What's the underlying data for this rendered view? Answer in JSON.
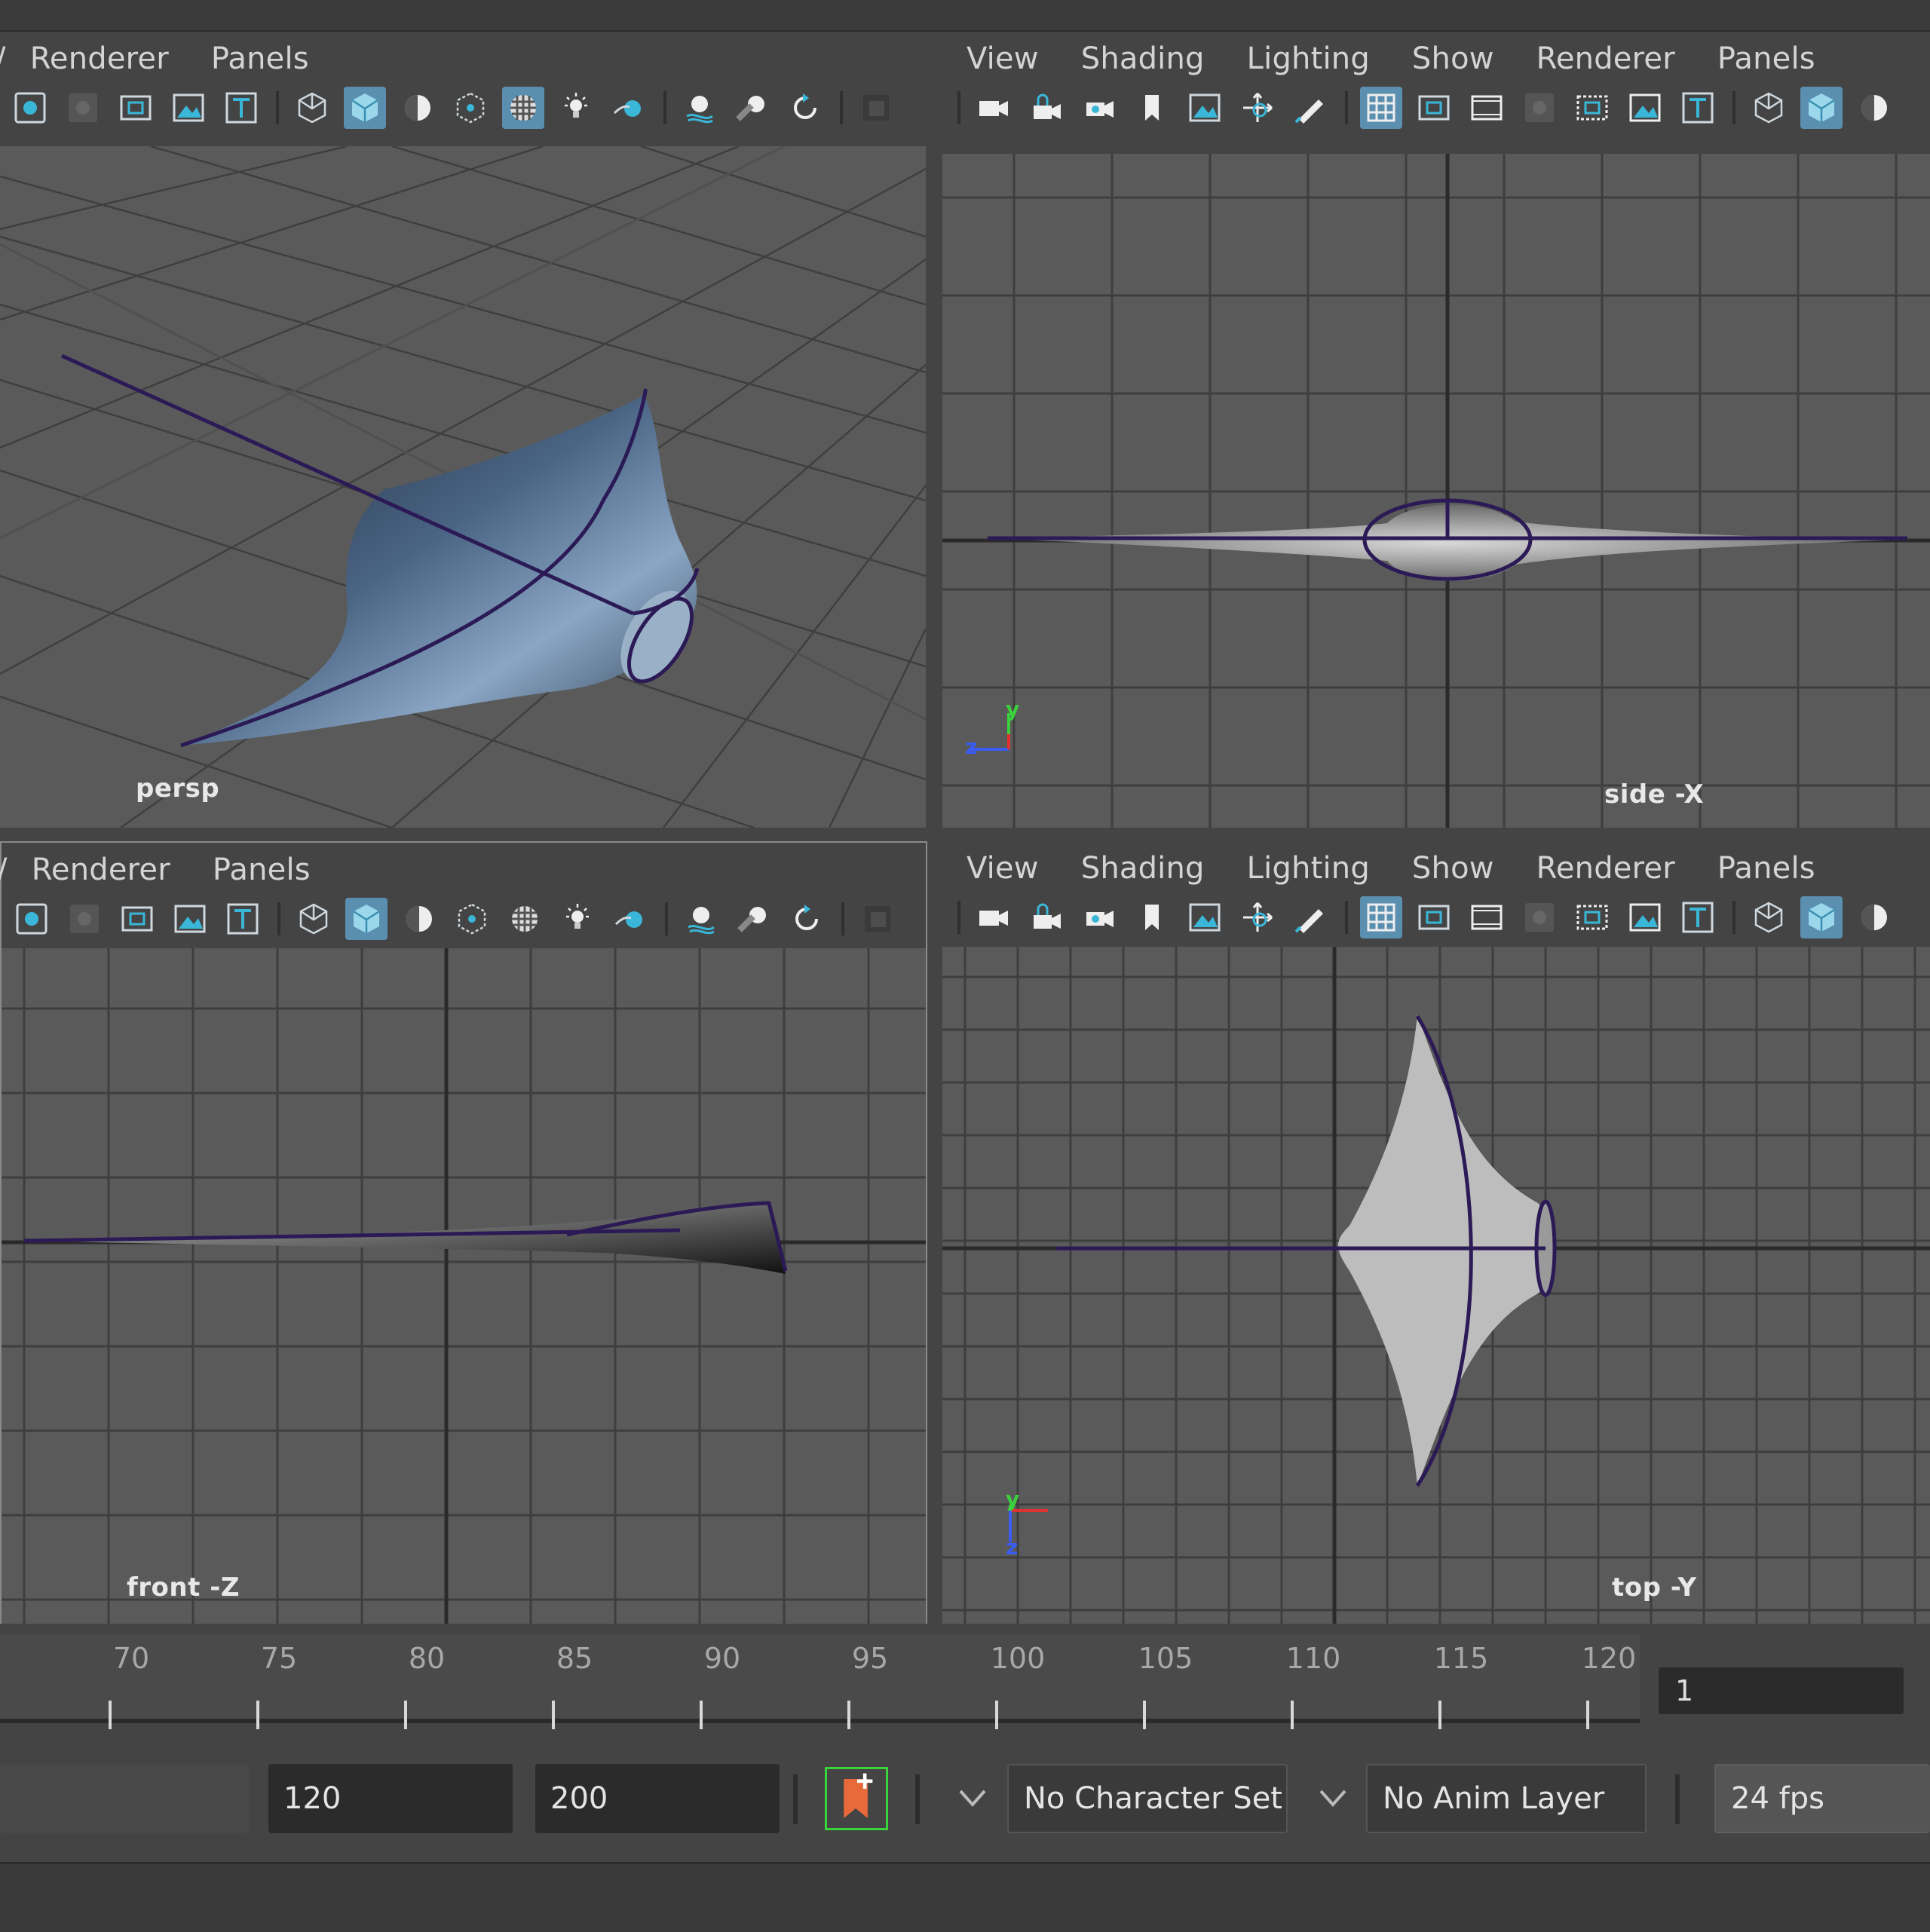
{
  "panels": {
    "persp": {
      "menus": [
        "Renderer",
        "Panels"
      ],
      "camera_label": "persp"
    },
    "side": {
      "menus": [
        "View",
        "Shading",
        "Lighting",
        "Show",
        "Renderer",
        "Panels"
      ],
      "camera_label": "side -X",
      "axis_labels": {
        "y": "y",
        "z": "z"
      }
    },
    "front": {
      "menus": [
        "Renderer",
        "Panels"
      ],
      "camera_label": "front -Z"
    },
    "top": {
      "menus": [
        "View",
        "Shading",
        "Lighting",
        "Show",
        "Renderer",
        "Panels"
      ],
      "camera_label": "top -Y",
      "axis_labels": {
        "y": "y",
        "z": "z"
      }
    }
  },
  "toolbar_icons_left": [
    "isolate-icon",
    "shadow-icon",
    "film-gate-icon",
    "image-plane-icon",
    "text-icon",
    "wireframe-icon",
    "smooth-shade-icon",
    "shade-half-icon",
    "bounding-box-icon",
    "checker-icon",
    "light-icon",
    "xray-icon",
    "motion-trail-icon",
    "ambient-occlusion-icon",
    "refresh-icon",
    "hud-icon"
  ],
  "toolbar_icons_right": [
    "camera-icon",
    "lock-camera-icon",
    "camera-attr-icon",
    "bookmark-icon",
    "image-plane-icon",
    "pan-zoom-icon",
    "grease-pencil-icon",
    "grid-icon",
    "film-gate-icon",
    "resolution-gate-icon",
    "shadow-icon",
    "field-chart-icon",
    "image-icon",
    "text-icon",
    "wireframe-icon",
    "smooth-shade-icon",
    "shade-half-icon"
  ],
  "timeline": {
    "ticks": [
      "70",
      "75",
      "80",
      "85",
      "90",
      "95",
      "100",
      "105",
      "110",
      "115",
      "120"
    ],
    "current_frame": "1"
  },
  "range": {
    "end_time": "120",
    "max_time": "200",
    "character_set": "No Character Set",
    "anim_layer": "No Anim Layer",
    "fps": "24 fps"
  },
  "colors": {
    "accent": "#5a8fb0",
    "curve": "#2b1a55",
    "viewport_bg": "#5a5a5a",
    "key_icon": "#e86a3a",
    "key_frame": "#39d33a"
  }
}
